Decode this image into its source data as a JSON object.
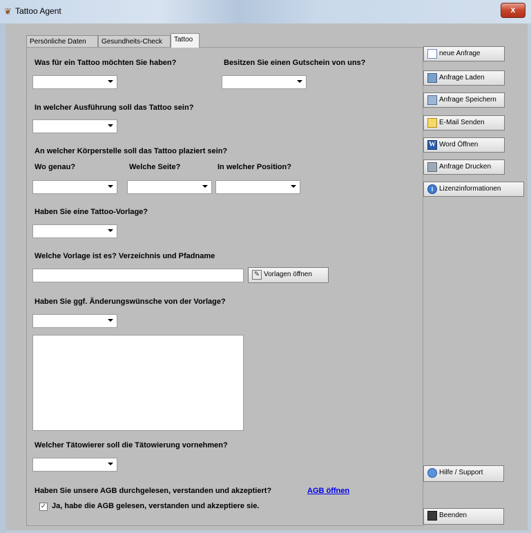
{
  "window": {
    "title": "Tattoo Agent",
    "close_glyph": "x"
  },
  "tabs": [
    "Persönliche Daten",
    "Gesundheits-Check",
    "Tattoo"
  ],
  "form": {
    "q_tattoo_type": "Was für ein Tattoo möchten Sie haben?",
    "q_voucher": "Besitzen Sie einen Gutschein von uns?",
    "q_execution": "In welcher Ausführung soll das Tattoo sein?",
    "q_body_part": "An welcher Körperstelle soll das Tattoo plaziert sein?",
    "q_where": "Wo genau?",
    "q_side": "Welche Seite?",
    "q_position": "In welcher Position?",
    "q_template": "Haben Sie eine Tattoo-Vorlage?",
    "q_template_path": "Welche Vorlage ist es? Verzeichnis und Pfadname",
    "template_path_value": "",
    "open_templates_button": "Vorlagen öffnen",
    "q_changes": "Haben Sie ggf. Änderungswünsche von der Vorlage?",
    "changes_text": "",
    "q_artist": "Welcher Tätowierer soll die Tätowierung vornehmen?",
    "q_agb": "Haben Sie unsere AGB durchgelesen, verstanden und akzeptiert?",
    "agb_link": "AGB öffnen",
    "agb_checkbox_label": "Ja, habe die AGB gelesen, verstanden und akzeptiere sie.",
    "agb_checked": true,
    "check_glyph": "✓",
    "combos": {
      "tattoo_type": "",
      "voucher": "",
      "execution": "",
      "where": "",
      "side": "",
      "position": "",
      "template": "",
      "changes": "",
      "artist": ""
    }
  },
  "sidebar": {
    "buttons": [
      {
        "label": "neue Anfrage",
        "icon": "new-document-icon"
      },
      {
        "label": "Anfrage Laden",
        "icon": "load-icon"
      },
      {
        "label": "Anfrage Speichern",
        "icon": "save-icon"
      },
      {
        "label": "E-Mail Senden",
        "icon": "mail-icon"
      },
      {
        "label": "Word Öffnen",
        "icon": "word-icon"
      },
      {
        "label": "Anfrage Drucken",
        "icon": "print-icon"
      },
      {
        "label": "Lizenzinformationen",
        "icon": "info-icon"
      }
    ],
    "help_button": "Hilfe / Support",
    "exit_button": "Beenden",
    "info_glyph": "i",
    "word_glyph": "W",
    "pen_glyph": "✎"
  }
}
